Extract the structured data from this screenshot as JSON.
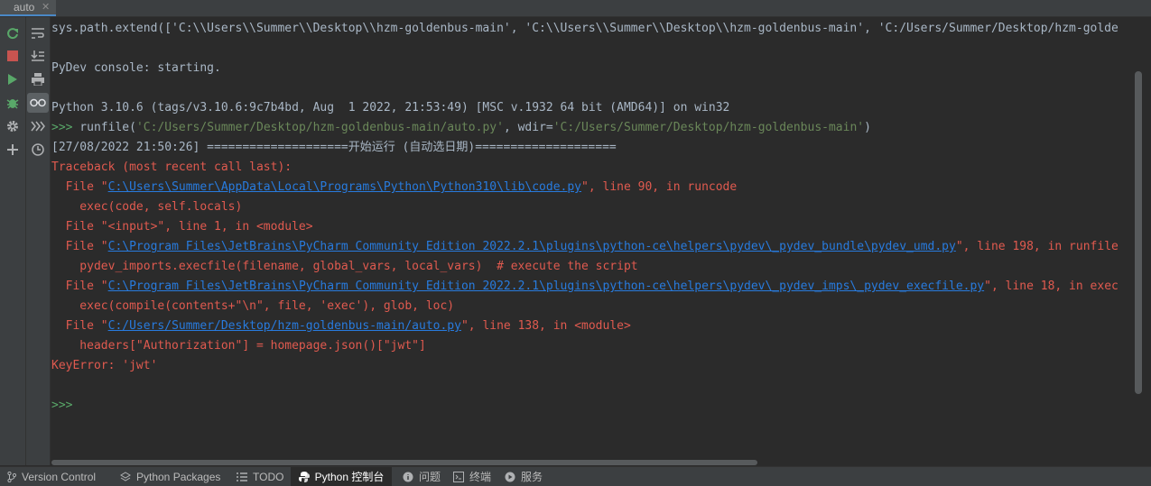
{
  "tab": {
    "label": "auto",
    "close": "✕"
  },
  "toolbar": {
    "rerun": "rerun-icon",
    "stop": "stop-icon",
    "run": "run-icon",
    "debug": "debug-icon",
    "settings": "gear-icon",
    "add": "add-icon",
    "soft_wrap": "soft-wrap-icon",
    "scroll_end": "scroll-to-end-icon",
    "print": "print-icon",
    "variables": "show-variables-icon",
    "execute": "execute-icon",
    "history": "history-icon"
  },
  "console": {
    "l1": "sys.path.extend(['C:\\\\Users\\\\Summer\\\\Desktop\\\\hzm-goldenbus-main', 'C:\\\\Users\\\\Summer\\\\Desktop\\\\hzm-goldenbus-main', 'C:/Users/Summer/Desktop/hzm-golde",
    "l2": "PyDev console: starting.",
    "l3": "Python 3.10.6 (tags/v3.10.6:9c7b4bd, Aug  1 2022, 21:53:49) [MSC v.1932 64 bit (AMD64)] on win32",
    "prompt": ">>>",
    "runfile_a": " runfile(",
    "runfile_path": "'C:/Users/Summer/Desktop/hzm-goldenbus-main/auto.py'",
    "runfile_b": ", wdir=",
    "runfile_wdir": "'C:/Users/Summer/Desktop/hzm-goldenbus-main'",
    "runfile_c": ")",
    "l5": "[27/08/2022 21:50:26] ====================开始运行 (自动选日期)====================",
    "l6": "Traceback (most recent call last):",
    "f1_pre": "  File \"",
    "f1_link": "C:\\Users\\Summer\\AppData\\Local\\Programs\\Python\\Python310\\lib\\code.py",
    "f1_post": "\", line 90, in runcode",
    "l8": "    exec(code, self.locals)",
    "l9": "  File \"<input>\", line 1, in <module>",
    "f2_pre": "  File \"",
    "f2_link": "C:\\Program Files\\JetBrains\\PyCharm Community Edition 2022.2.1\\plugins\\python-ce\\helpers\\pydev\\_pydev_bundle\\pydev_umd.py",
    "f2_post": "\", line 198, in runfile",
    "l11": "    pydev_imports.execfile(filename, global_vars, local_vars)  # execute the script",
    "f3_pre": "  File \"",
    "f3_link": "C:\\Program Files\\JetBrains\\PyCharm Community Edition 2022.2.1\\plugins\\python-ce\\helpers\\pydev\\_pydev_imps\\_pydev_execfile.py",
    "f3_post": "\", line 18, in exec",
    "l13": "    exec(compile(contents+\"\\n\", file, 'exec'), glob, loc)",
    "f4_pre": "  File \"",
    "f4_link": "C:/Users/Summer/Desktop/hzm-goldenbus-main/auto.py",
    "f4_post": "\", line 138, in <module>",
    "l15": "    headers[\"Authorization\"] = homepage.json()[\"jwt\"]",
    "l16": "KeyError: 'jwt'",
    "input_prompt": ">>>"
  },
  "bottom": {
    "version_control": "Version Control",
    "python_packages": "Python Packages",
    "todo": "TODO",
    "python_console": "Python 控制台",
    "problems": "问题",
    "terminal": "终端",
    "services": "服务"
  },
  "colors": {
    "background": "#2b2b2b",
    "panel": "#3c3f41",
    "error": "#e05a4f",
    "link": "#287bde",
    "prompt": "#59a869",
    "string": "#6a8759"
  }
}
